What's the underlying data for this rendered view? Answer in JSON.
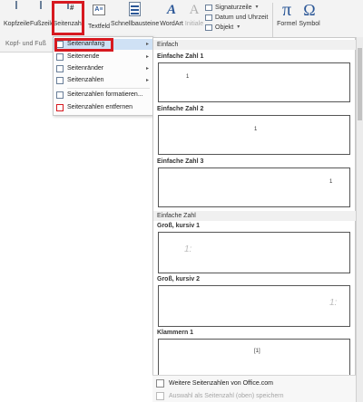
{
  "ribbon": {
    "kopfzeile": "Kopfzeile",
    "fusszeile": "Fußzeile",
    "seitenzahl": "Seitenzahl",
    "textfeld": "Textfeld",
    "schnellbausteine": "Schnellbausteine",
    "wordart": "WordArt",
    "initiale": "Initiale",
    "signaturzeile": "Signaturzeile",
    "datum_uhrzeit": "Datum und Uhrzeit",
    "objekt": "Objekt",
    "formel": "Formel",
    "symbol": "Symbol",
    "group_kopf": "Kopf- und Fuß",
    "textfeld_glyph": "A≡",
    "wordart_glyph": "A",
    "initiale_glyph": "A",
    "formel_glyph": "π",
    "symbol_glyph": "Ω"
  },
  "menu": {
    "items": [
      {
        "label": "Seitenanfang",
        "submenu": true,
        "highlighted": true
      },
      {
        "label": "Seitenende",
        "submenu": true
      },
      {
        "label": "Seitenränder",
        "submenu": true
      },
      {
        "label": "Seitenzahlen",
        "submenu": true
      },
      {
        "label": "Seitenzahlen formatieren...",
        "submenu": false
      },
      {
        "label": "Seitenzahlen entfernen",
        "submenu": false
      }
    ],
    "submenu_arrow": "▸"
  },
  "gallery": {
    "section1": "Einfach",
    "items1": [
      {
        "title": "Einfache Zahl 1",
        "mark": "1"
      },
      {
        "title": "Einfache Zahl 2",
        "mark": "1"
      },
      {
        "title": "Einfache Zahl 3",
        "mark": "1"
      }
    ],
    "section2": "Einfache Zahl",
    "items2": [
      {
        "title": "Groß, kursiv 1",
        "mark": "1:"
      },
      {
        "title": "Groß, kursiv 2",
        "mark": "1:"
      },
      {
        "title": "Klammern 1",
        "mark": "[1]"
      }
    ],
    "footer": {
      "more": "Weitere Seitenzahlen von Office.com",
      "save": "Auswahl als Seitenzahl (oben) speichern"
    }
  }
}
